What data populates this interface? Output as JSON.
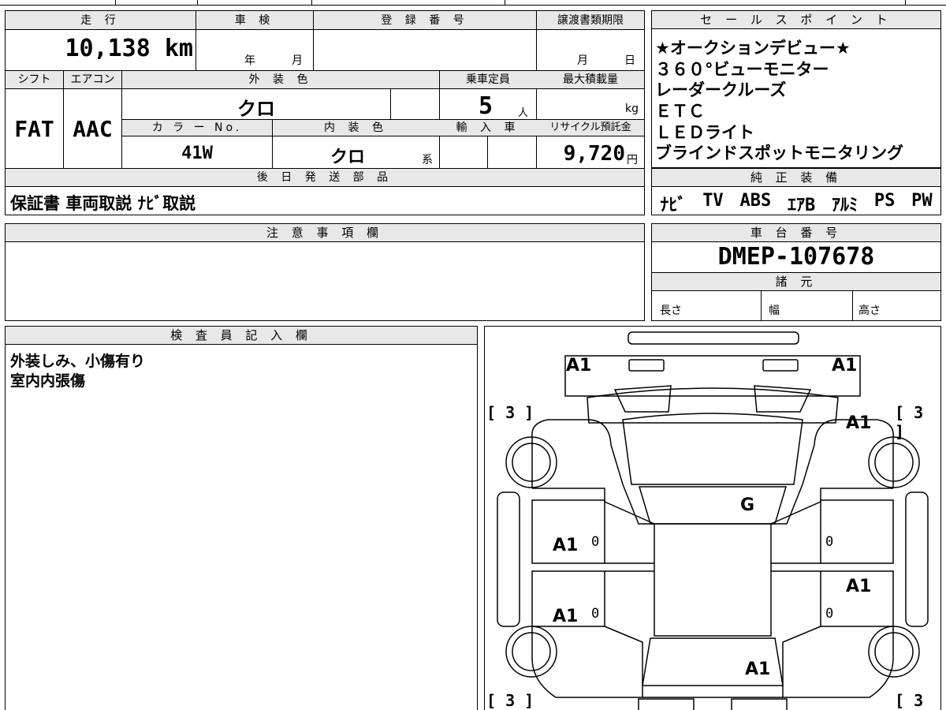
{
  "main": {
    "h_mileage": "走 行",
    "h_inspection": "車 検",
    "h_reg_no": "登 録 番 号",
    "h_transfer": "譲渡書類期限",
    "mileage": "10,138 km",
    "insp_year": "年",
    "insp_month": "月",
    "transfer_month": "月",
    "transfer_day": "日",
    "h_shift": "シフト",
    "h_aircon": "エアコン",
    "h_ext_color": "外 装 色",
    "h_capacity": "乗車定員",
    "h_max_load": "最大積載量",
    "shift": "FAT",
    "aircon": "AAC",
    "ext_color": "クロ",
    "capacity": "5",
    "capacity_unit": "人",
    "load_unit": "kg",
    "h_color_no": "カ ラ ー No.",
    "h_int_color": "内 装 色",
    "h_import": "輸 入 車",
    "h_recycle": "リサイクル預託金",
    "color_no": "41W",
    "int_color": "クロ",
    "int_suffix": "系",
    "recycle": "9,720",
    "recycle_unit": "円",
    "h_later_parts": "後 日 発 送 部 品",
    "later_parts": "保証書 車両取説 ﾅﾋﾞ取説"
  },
  "sales": {
    "header": "セ ー ル ス ポ イ ン ト",
    "lines": [
      "★オークションデビュー★",
      "３６０°ビューモニター",
      "レーダークルーズ",
      "ＥＴＣ",
      "ＬＥＤライト",
      "ブラインドスポットモニタリング"
    ]
  },
  "equip": {
    "header": "純 正 装 備",
    "items": [
      "ﾅﾋﾞ",
      "TV",
      "ABS",
      "ｴｱB",
      "ｱﾙﾐ",
      "PS",
      "PW"
    ]
  },
  "notes": {
    "header": "注 意 事 項 欄"
  },
  "chassis": {
    "header": "車 台 番 号",
    "number": "DMEP-107678",
    "specs_header": "諸 元",
    "length": "長さ",
    "width": "幅",
    "height": "高さ"
  },
  "inspector": {
    "header": "検 査 員 記 入 欄",
    "lines": [
      "外装しみ、小傷有り",
      "室内内張傷"
    ]
  },
  "diagram": {
    "front_left": "A1",
    "front_right": "A1",
    "fender_right": "A1",
    "roof": "G",
    "door_fl": "A1",
    "door_rl": "A1",
    "door_rr": "A1",
    "rear": "A1",
    "zero": "0",
    "bracket": "[ 3 ]"
  }
}
